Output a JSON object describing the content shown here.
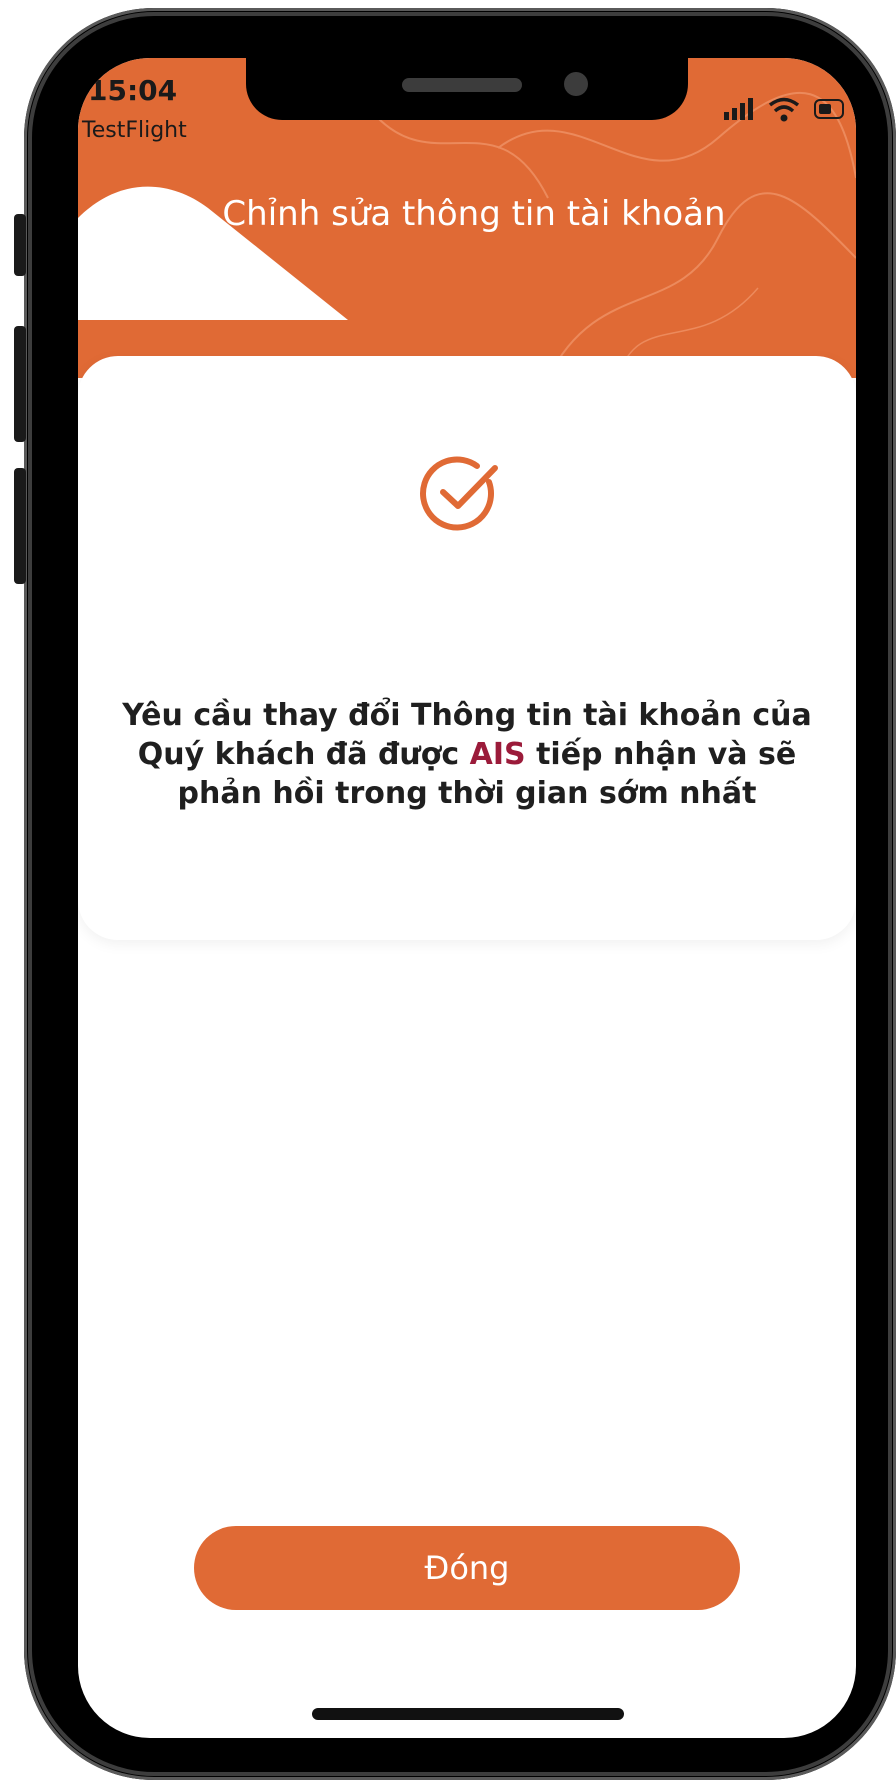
{
  "status_bar": {
    "time": "15:04",
    "subtitle": "TestFlight"
  },
  "header": {
    "title": "Chỉnh sửa thông tin tài khoản"
  },
  "message": {
    "part1": "Yêu cầu thay đổi Thông tin tài khoản của Quý khách đã được ",
    "highlight": "AIS",
    "part2": " tiếp nhận và sẽ phản hồi trong thời gian sớm nhất"
  },
  "close_button": {
    "label": "Đóng"
  },
  "colors": {
    "brand_orange": "#e06a35",
    "accent_red": "#9b1b3a"
  },
  "icons": {
    "success": "check-circle-icon",
    "signal": "cellular-signal-icon",
    "wifi": "wifi-icon",
    "battery": "battery-icon"
  }
}
